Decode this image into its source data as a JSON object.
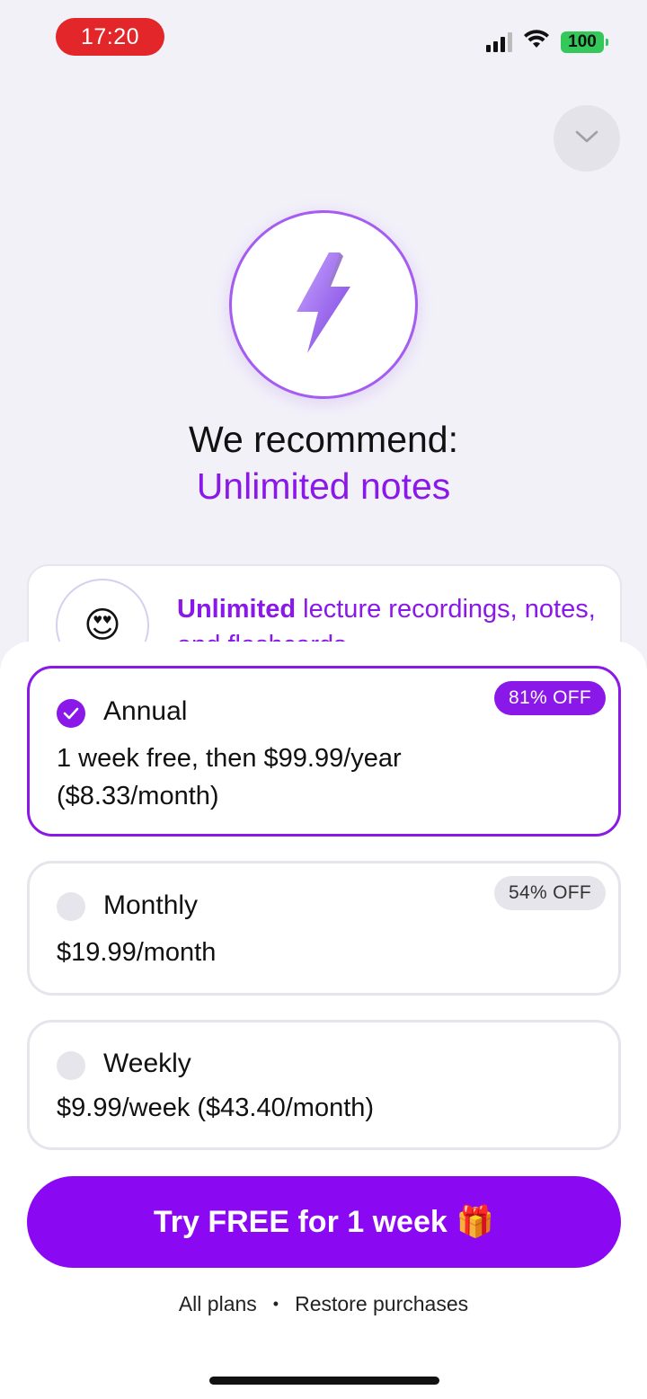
{
  "status_bar": {
    "time": "17:20",
    "battery": "100",
    "signal_icon": "signal-icon",
    "wifi_icon": "wifi-icon"
  },
  "header": {
    "close_icon": "chevron-down-icon",
    "hero_icon": "lightning-bolt-icon"
  },
  "headline": {
    "line1": "We recommend:",
    "line2": "Unlimited notes"
  },
  "feature": {
    "emoji": "😍",
    "bold": "Unlimited",
    "text": " lecture recordings, notes, and flashcards"
  },
  "plans": [
    {
      "name": "Annual",
      "desc_line1": "1 week free, then $99.99/year",
      "desc_line2": "($8.33/month)",
      "badge": "81% OFF",
      "selected": true
    },
    {
      "name": "Monthly",
      "desc_line1": "$19.99/month",
      "badge": "54% OFF",
      "selected": false
    },
    {
      "name": "Weekly",
      "desc_line1": "$9.99/week ($43.40/month)",
      "selected": false
    }
  ],
  "cta": {
    "label": "Try FREE for 1 week",
    "emoji": "🎁"
  },
  "footer": {
    "all_plans": "All plans",
    "separator": "•",
    "restore": "Restore purchases"
  },
  "colors": {
    "accent": "#8a18e8",
    "background": "#f2f1f8",
    "time_pill": "#e2262a",
    "battery": "#34c759"
  }
}
